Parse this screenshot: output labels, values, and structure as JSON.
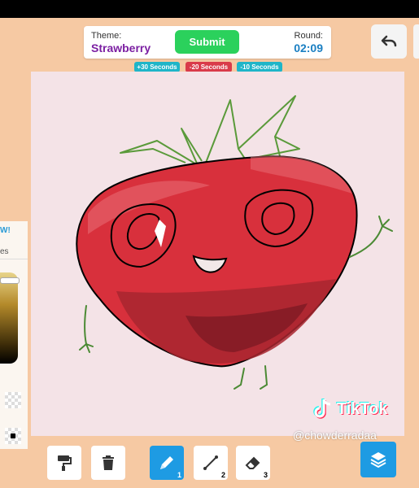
{
  "header": {
    "theme_label": "Theme:",
    "theme_value": "Strawberry",
    "submit_label": "Submit",
    "round_label": "Round:",
    "round_value": "02:09"
  },
  "time_modifiers": [
    {
      "label": "+30 Seconds"
    },
    {
      "label": "-20 Seconds"
    },
    {
      "label": "-10 Seconds"
    }
  ],
  "left_panel": {
    "new_text": "W!",
    "label_text": "es",
    "brush_size": 0.05
  },
  "toolbar": {
    "tools": [
      {
        "number": "1",
        "icon": "pencil-icon"
      },
      {
        "number": "2",
        "icon": "line-icon"
      },
      {
        "number": "3",
        "icon": "eraser-icon"
      }
    ]
  },
  "watermark": {
    "brand": "TikTok",
    "handle": "@chowderradaa"
  },
  "colors": {
    "accent": "#1e9be3",
    "submit": "#2bd15c",
    "theme_text": "#7b1fa2",
    "strawberry": "#d8303c"
  }
}
